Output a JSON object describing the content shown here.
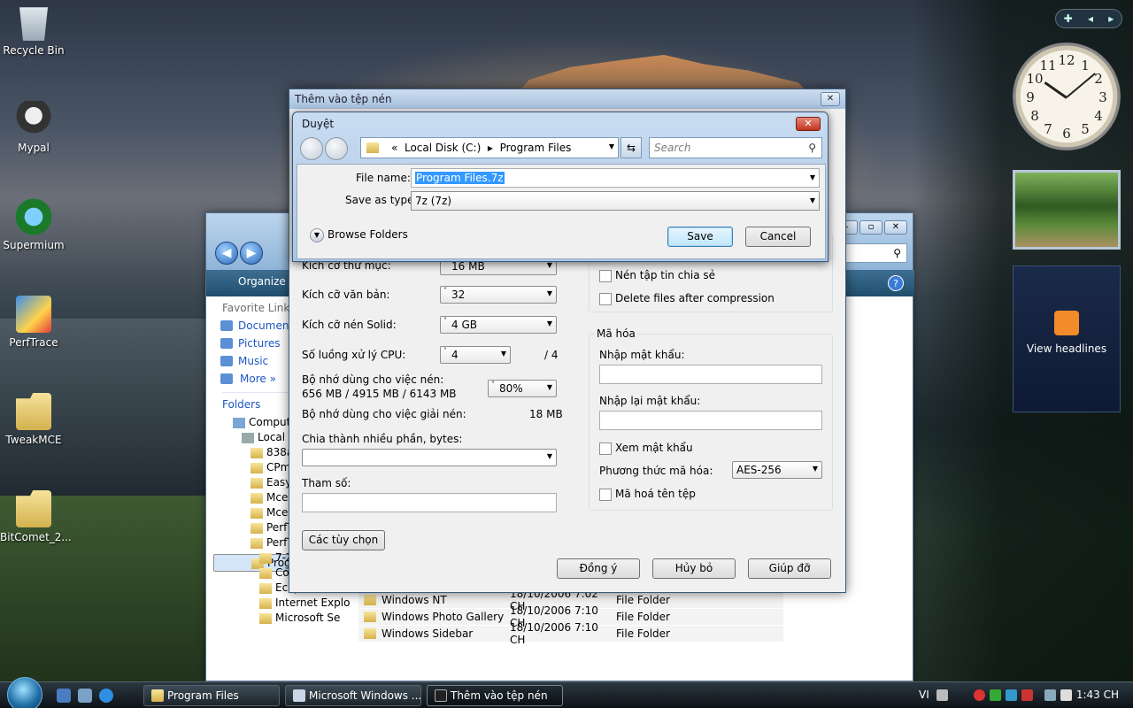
{
  "desktop_icons": [
    {
      "label": "Recycle Bin"
    },
    {
      "label": "Mypal"
    },
    {
      "label": "Supermium"
    },
    {
      "label": "PerfTrace"
    },
    {
      "label": "TweakMCE"
    },
    {
      "label": "BitComet_2..."
    }
  ],
  "gadgets": {
    "headlines_label": "View headlines",
    "clock_numbers": [
      "12",
      "1",
      "2",
      "3",
      "4",
      "5",
      "6",
      "7",
      "8",
      "9",
      "10",
      "11"
    ]
  },
  "explorer": {
    "toolbar_organize": "Organize",
    "favorite_links_title": "Favorite Links",
    "favorites": [
      "Documents",
      "Pictures",
      "Music"
    ],
    "more_label": "More",
    "folders_title": "Folders",
    "tree": [
      "Computer",
      "Local Disk (C:)",
      "838a",
      "CPm",
      "Easy",
      "Mce",
      "Mce",
      "PerfT",
      "PerfT",
      "Program Files",
      "7-Zip",
      "Common Files",
      "Eclipse Com",
      "Internet Explo",
      "Microsoft Se"
    ],
    "rows": [
      {
        "name": "Windows NT",
        "date": "18/10/2006 7:02 CH",
        "type": "File Folder"
      },
      {
        "name": "Windows Photo Gallery",
        "date": "18/10/2006 7:10 CH",
        "type": "File Folder"
      },
      {
        "name": "Windows Sidebar",
        "date": "18/10/2006 7:10 CH",
        "type": "File Folder"
      }
    ]
  },
  "compress_dialog": {
    "title": "Thêm vào tệp nén",
    "dict_size_label": "Kích cỡ thư mục:",
    "dict_size_value": "16 MB",
    "word_size_label": "Kích cỡ văn bản:",
    "word_size_value": "32",
    "solid_label": "Kích cỡ nén Solid:",
    "solid_value": "4 GB",
    "cpu_label": "Số luồng xử lý CPU:",
    "cpu_value": "4",
    "cpu_total": "/ 4",
    "mem_comp_label": "Bộ nhớ dùng cho việc nén:",
    "mem_comp_values": "656 MB / 4915 MB / 6143 MB",
    "mem_comp_percent": "80%",
    "mem_decomp_label": "Bộ nhớ dùng cho việc giải nén:",
    "mem_decomp_value": "18 MB",
    "split_label": "Chia thành nhiều phần, bytes:",
    "params_label": "Tham số:",
    "options_button": "Các tùy chọn",
    "shared_files": "Nén tập tin chia sẻ",
    "delete_after": "Delete files after compression",
    "encryption_group": "Mã hóa",
    "password_label": "Nhập mật khẩu:",
    "reenter_label": "Nhập lại mật khẩu:",
    "show_password": "Xem mật khẩu",
    "method_label": "Phương thức mã hóa:",
    "method_value": "AES-256",
    "encrypt_names": "Mã hoá tên tệp",
    "ok_button": "Đồng ý",
    "cancel_button": "Hủy bỏ",
    "help_button": "Giúp đỡ"
  },
  "browse_dialog": {
    "title": "Duyệt",
    "path_prefix": "«",
    "path_disk": "Local Disk (C:)",
    "path_sep": "▸",
    "path_folder": "Program Files",
    "search_placeholder": "Search",
    "file_name_label": "File name:",
    "file_name_value": "Program Files.7z",
    "save_type_label": "Save as type:",
    "save_type_value": "7z (7z)",
    "browse_folders": "Browse Folders",
    "save_button": "Save",
    "cancel_button": "Cancel"
  },
  "taskbar": {
    "tasks": [
      {
        "label": "Program Files"
      },
      {
        "label": "Microsoft Windows ..."
      },
      {
        "label": "Thêm vào tệp nén"
      }
    ],
    "language": "VI",
    "time": "1:43 CH"
  }
}
